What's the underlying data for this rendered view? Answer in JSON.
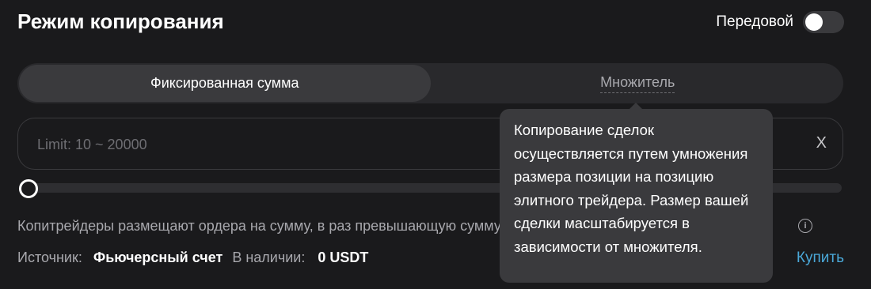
{
  "header": {
    "title": "Режим копирования",
    "advanced_label": "Передовой",
    "advanced_enabled": false
  },
  "tabs": [
    {
      "label": "Фиксированная сумма",
      "active": true
    },
    {
      "label": "Множитель",
      "active": false
    }
  ],
  "amount_input": {
    "placeholder": "Limit: 10 ~ 20000",
    "value": "",
    "clear_label": "X"
  },
  "slider": {
    "value": 0
  },
  "description": "Копитрейдеры размещают ордера на сумму, в раз превышающую сумму ордеров элитного трейдера.",
  "source": {
    "label": "Источник:",
    "value": "Фьючерсный счет",
    "available_label": "В наличии:",
    "available_value": "0 USDT",
    "buy_label": "Купить"
  },
  "tooltip": {
    "text": "Копирование сделок осуществляется путем умножения размера позиции на позицию элитного трейдера. Размер вашей сделки масштабируется в зависимости от множителя."
  },
  "colors": {
    "background": "#1a1a1c",
    "accent": "#4aa8d8",
    "tooltip_bg": "#3a3a3d"
  }
}
